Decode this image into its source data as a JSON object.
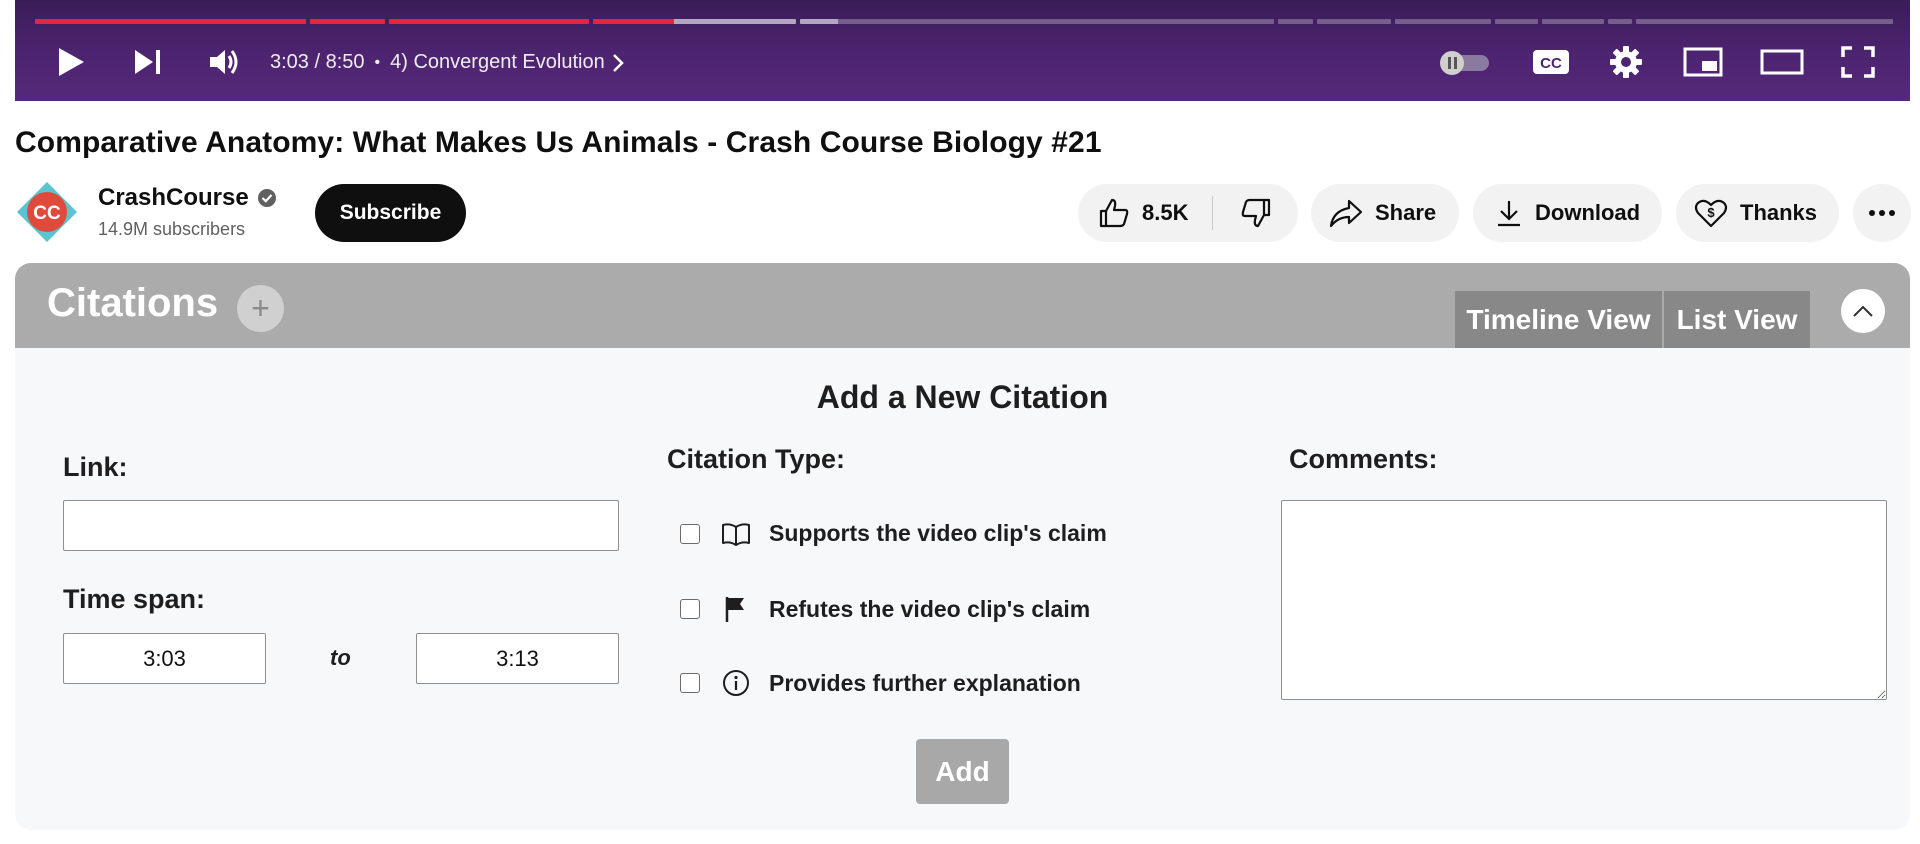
{
  "player": {
    "time_display": "3:03 / 8:50",
    "separator": "•",
    "chapter_title": "4) Convergent Evolution",
    "progress_fraction": 0.343,
    "buffered_fraction": 0.43,
    "colors": {
      "played": "#e3263a",
      "background": "#4d2470"
    }
  },
  "video": {
    "title": "Comparative Anatomy: What Makes Us Animals - Crash Course Biology #21"
  },
  "channel": {
    "name": "CrashCourse",
    "subscribers": "14.9M subscribers",
    "subscribe_label": "Subscribe",
    "avatar_text": "CC",
    "verified_icon": "verified-check-icon"
  },
  "actions": {
    "like_count": "8.5K",
    "share_label": "Share",
    "download_label": "Download",
    "thanks_label": "Thanks"
  },
  "citations": {
    "panel_title": "Citations",
    "add_icon": "+",
    "timeline_view_label": "Timeline View",
    "list_view_label": "List View",
    "form_title": "Add a New Citation",
    "link_label": "Link:",
    "link_value": "",
    "time_span_label": "Time span:",
    "time_from": "3:03",
    "time_to": "3:13",
    "to_label": "to",
    "citation_type_label": "Citation Type:",
    "types": [
      {
        "label": "Supports the video clip's claim",
        "icon": "open-book-icon",
        "checked": false
      },
      {
        "label": "Refutes the video clip's claim",
        "icon": "flag-icon",
        "checked": false
      },
      {
        "label": "Provides further explanation",
        "icon": "info-icon",
        "checked": false
      }
    ],
    "comments_label": "Comments:",
    "comments_value": "",
    "add_button_label": "Add"
  }
}
